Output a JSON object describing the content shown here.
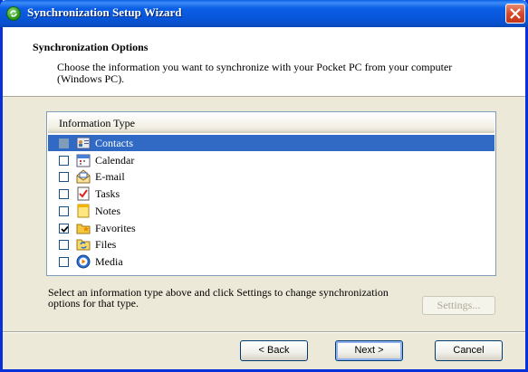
{
  "window": {
    "title": "Synchronization Setup Wizard"
  },
  "header": {
    "title": "Synchronization Options",
    "description": "Choose the information you want to synchronize with your Pocket PC from your computer (Windows PC)."
  },
  "list": {
    "column_header": "Information Type",
    "items": [
      {
        "label": "Contacts",
        "checked": false,
        "selected": true,
        "icon": "contacts-icon"
      },
      {
        "label": "Calendar",
        "checked": false,
        "selected": false,
        "icon": "calendar-icon"
      },
      {
        "label": "E-mail",
        "checked": false,
        "selected": false,
        "icon": "email-icon"
      },
      {
        "label": "Tasks",
        "checked": false,
        "selected": false,
        "icon": "tasks-icon"
      },
      {
        "label": "Notes",
        "checked": false,
        "selected": false,
        "icon": "notes-icon"
      },
      {
        "label": "Favorites",
        "checked": true,
        "selected": false,
        "icon": "favorites-icon"
      },
      {
        "label": "Files",
        "checked": false,
        "selected": false,
        "icon": "files-icon"
      },
      {
        "label": "Media",
        "checked": false,
        "selected": false,
        "icon": "media-icon"
      }
    ]
  },
  "info": {
    "text": "Select an information type above and click Settings to change synchronization options for that type."
  },
  "buttons": {
    "settings": "Settings...",
    "back": "< Back",
    "next": "Next >",
    "cancel": "Cancel"
  },
  "colors": {
    "titlebar": "#0755d8",
    "selection": "#316ac5",
    "dialog_bg": "#ece9d8"
  }
}
